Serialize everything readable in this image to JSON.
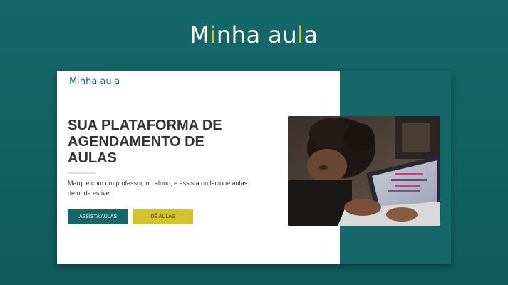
{
  "brand": {
    "name_before": "M",
    "name_accent_1": "i",
    "name_middle": "nha au",
    "name_accent_2": "l",
    "name_after": "a"
  },
  "colors": {
    "background": "#136163",
    "primary": "#15676a",
    "accent": "#d4c62c",
    "text": "#333333"
  },
  "hero": {
    "headline": "SUA PLATAFORMA DE AGENDAMENTO DE AULAS",
    "description": "Marque com um professor, ou aluno, e assista ou lecione aulas de onde estiver"
  },
  "buttons": {
    "assista_label": "ASSISTA AULAS",
    "de_label": "DÊ AULAS"
  },
  "image": {
    "icon": "student-laptop-photo"
  }
}
